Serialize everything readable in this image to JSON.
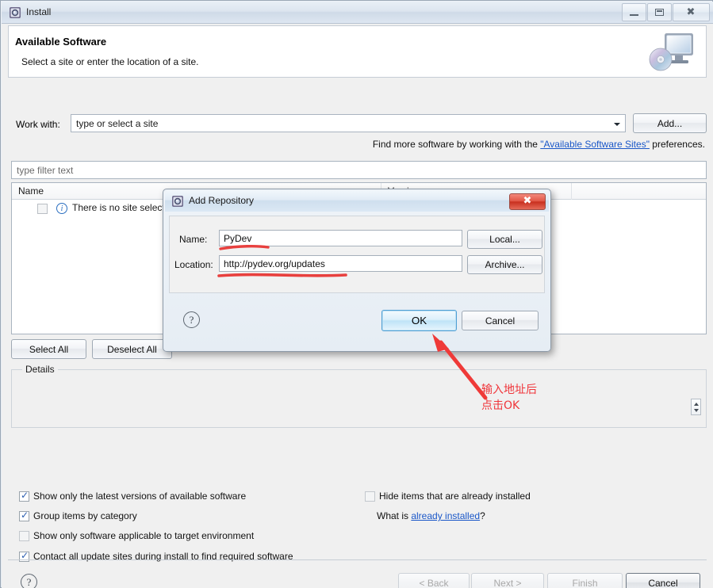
{
  "window": {
    "title": "Install",
    "icon": "install-icon",
    "buttons": {
      "minimize": "minimize-icon",
      "maximize": "maximize-icon",
      "close": "close-icon"
    }
  },
  "header": {
    "title": "Available Software",
    "subtitle": "Select a site or enter the location of a site.",
    "icon": "monitor-disc-icon"
  },
  "work_with": {
    "label": "Work with:",
    "value": "type or select a site",
    "placeholder": "type or select a site",
    "add_button": "Add..."
  },
  "find_more": {
    "prefix": "Find more software by working with the ",
    "link": "\"Available Software Sites\"",
    "suffix": " preferences."
  },
  "filter": {
    "placeholder": "type filter text",
    "value": ""
  },
  "table": {
    "columns": [
      "Name",
      "Version",
      ""
    ],
    "rows": [
      {
        "checked": false,
        "icon": "info-icon",
        "name": "There is no site selected.",
        "version": ""
      }
    ]
  },
  "list_buttons": {
    "select_all": "Select All",
    "deselect_all": "Deselect All"
  },
  "details": {
    "label": "Details",
    "text": ""
  },
  "options": {
    "left": [
      {
        "label": "Show only the latest versions of available software",
        "checked": true
      },
      {
        "label": "Group items by category",
        "checked": true
      },
      {
        "label": "Show only software applicable to target environment",
        "checked": false
      },
      {
        "label": "Contact all update sites during install to find required software",
        "checked": true
      }
    ],
    "right": [
      {
        "label": "Hide items that are already installed",
        "checked": false
      }
    ],
    "what_is": {
      "prefix": "What is ",
      "link": "already installed",
      "suffix": "?"
    }
  },
  "wizard_buttons": {
    "help": "?",
    "back": "< Back",
    "next": "Next >",
    "finish": "Finish",
    "cancel": "Cancel"
  },
  "dialog": {
    "title": "Add Repository",
    "icon": "install-icon",
    "close": "close-icon",
    "name_label": "Name:",
    "name_value": "PyDev",
    "location_label": "Location:",
    "location_value": "http://pydev.org/updates",
    "local_button": "Local...",
    "archive_button": "Archive...",
    "help": "?",
    "ok_button": "OK",
    "cancel_button": "Cancel"
  },
  "annotation": {
    "text": "输入地址后\n点击OK",
    "color": "#f0353a"
  }
}
